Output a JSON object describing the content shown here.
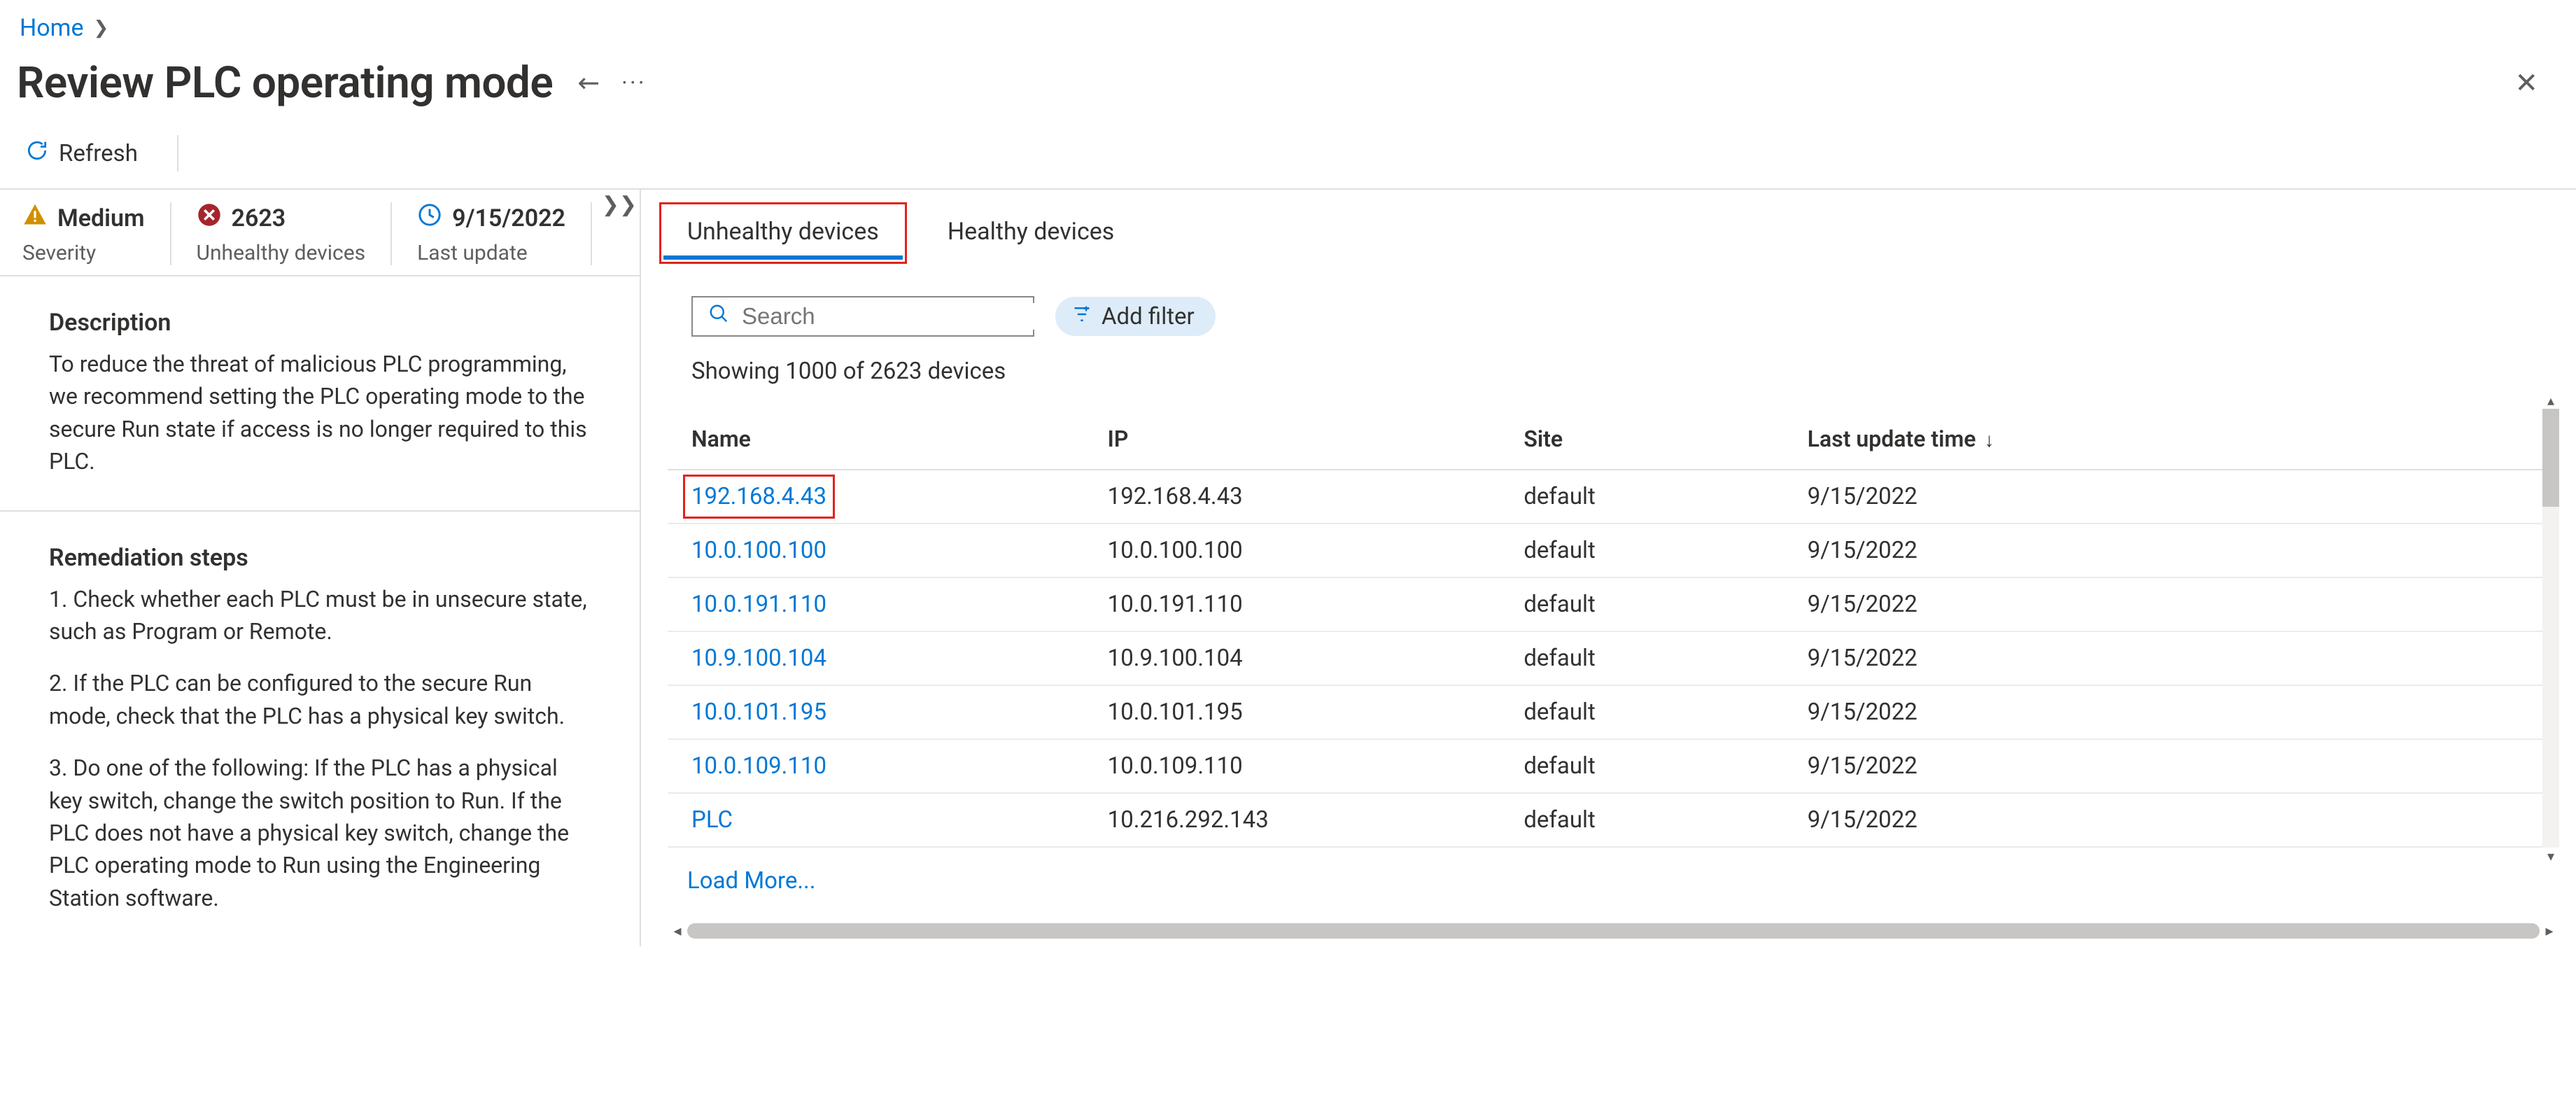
{
  "breadcrumb": {
    "home": "Home"
  },
  "page": {
    "title": "Review PLC operating mode"
  },
  "commands": {
    "refresh": "Refresh"
  },
  "metrics": {
    "severity": {
      "value": "Medium",
      "label": "Severity"
    },
    "unhealthy": {
      "value": "2623",
      "label": "Unhealthy devices"
    },
    "last_update": {
      "value": "9/15/2022",
      "label": "Last update"
    }
  },
  "description": {
    "heading": "Description",
    "body": "To reduce the threat of malicious PLC programming, we recommend setting the PLC operating mode to the secure Run state if access is no longer required to this PLC."
  },
  "remediation": {
    "heading": "Remediation steps",
    "steps": [
      "1. Check whether each PLC must be in unsecure state, such as Program or Remote.",
      "2. If the PLC can be configured to the secure Run mode, check that the PLC has a physical key switch.",
      "3. Do one of the following: If the PLC has a physical key switch, change the switch position to Run. If the PLC does not have a physical key switch, change the PLC operating mode to Run using the Engineering Station software."
    ]
  },
  "tabs": {
    "unhealthy": "Unhealthy devices",
    "healthy": "Healthy devices"
  },
  "search": {
    "placeholder": "Search"
  },
  "filter": {
    "add": "Add filter"
  },
  "showing_text": "Showing 1000 of 2623 devices",
  "columns": {
    "name": "Name",
    "ip": "IP",
    "site": "Site",
    "updated": "Last update time"
  },
  "rows": [
    {
      "name": "192.168.4.43",
      "ip": "192.168.4.43",
      "site": "default",
      "updated": "9/15/2022"
    },
    {
      "name": "10.0.100.100",
      "ip": "10.0.100.100",
      "site": "default",
      "updated": "9/15/2022"
    },
    {
      "name": "10.0.191.110",
      "ip": "10.0.191.110",
      "site": "default",
      "updated": "9/15/2022"
    },
    {
      "name": "10.9.100.104",
      "ip": "10.9.100.104",
      "site": "default",
      "updated": "9/15/2022"
    },
    {
      "name": "10.0.101.195",
      "ip": "10.0.101.195",
      "site": "default",
      "updated": "9/15/2022"
    },
    {
      "name": "10.0.109.110",
      "ip": "10.0.109.110",
      "site": "default",
      "updated": "9/15/2022"
    },
    {
      "name": "PLC",
      "ip": "10.216.292.143",
      "site": "default",
      "updated": "9/15/2022"
    }
  ],
  "load_more": "Load More..."
}
